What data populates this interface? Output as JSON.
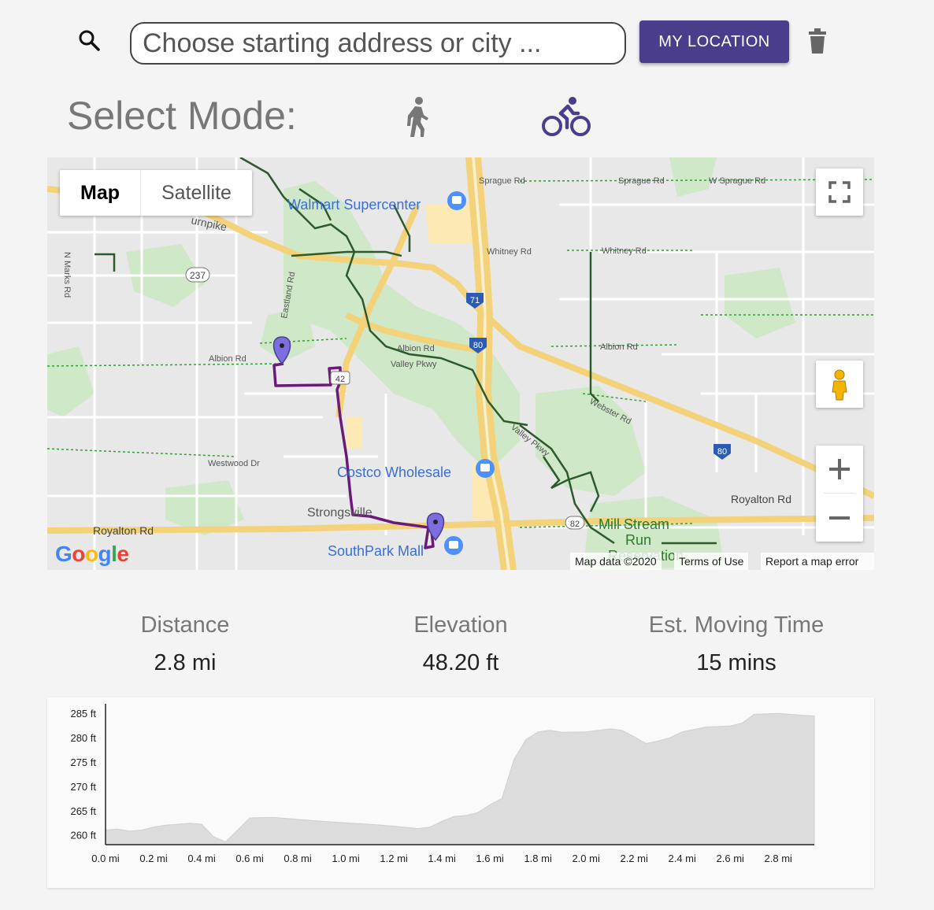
{
  "search": {
    "placeholder": "Choose starting address or city ...",
    "value": ""
  },
  "toolbar": {
    "my_location_label": "MY LOCATION"
  },
  "mode": {
    "label": "Select Mode:",
    "options": [
      "walk-icon",
      "bike-icon"
    ],
    "selected": "bike",
    "accent": "#4a3d8c"
  },
  "map": {
    "map_type_label": "Map",
    "satellite_label": "Satellite",
    "attribution": "Map data ©2020",
    "terms": "Terms of Use",
    "report": "Report a map error",
    "logo": "Google",
    "labels": {
      "walmart": "Walmart Supercenter",
      "costco": "Costco Wholesale",
      "southpark": "SouthPark Mall",
      "strongsville": "Strongsville",
      "millstream": "Mill Stream",
      "run": "Run",
      "reservation": "Reservation",
      "royalton_left": "Royalton Rd",
      "royalton_right": "Royalton Rd",
      "sprague1": "Sprague Rd",
      "sprague2": "Sprague Rd",
      "sprague3": "W Sprague Rd",
      "whitney1": "Whitney Rd",
      "whitney2": "Whitney Rd",
      "albion1": "Albion Rd",
      "albion2": "Albion Rd",
      "albion3": "Albion Rd",
      "valley1": "Valley Pkwy",
      "valley2": "Valley Pkwy",
      "westwood": "Westwood Dr",
      "webster": "Webster Rd",
      "eastland": "Eastland Rd",
      "nmarks": "N Marks Rd",
      "turnpike": "urnpike",
      "shield_237": "237",
      "shield_71": "71",
      "shield_80a": "80",
      "shield_80b": "80",
      "shield_42": "42",
      "shield_82": "82"
    }
  },
  "stats": {
    "distance_label": "Distance",
    "distance_value": "2.8 mi",
    "elevation_label": "Elevation",
    "elevation_value": "48.20 ft",
    "time_label": "Est. Moving Time",
    "time_value": "15 mins"
  },
  "chart_data": {
    "type": "area",
    "title": "",
    "xlabel": "",
    "ylabel": "",
    "xlim": [
      0,
      2.95
    ],
    "ylim": [
      258,
      286
    ],
    "x_ticks": [
      "0.0 mi",
      "0.2 mi",
      "0.4 mi",
      "0.6 mi",
      "0.8 mi",
      "1.0 mi",
      "1.2 mi",
      "1.4 mi",
      "1.6 mi",
      "1.8 mi",
      "2.0 mi",
      "2.2 mi",
      "2.4 mi",
      "2.6 mi",
      "2.8 mi"
    ],
    "y_ticks": [
      "260 ft",
      "265 ft",
      "270 ft",
      "275 ft",
      "280 ft",
      "285 ft"
    ],
    "series": [
      {
        "x": [
          0.0,
          0.05,
          0.1,
          0.15,
          0.2,
          0.25,
          0.3,
          0.35,
          0.4,
          0.45,
          0.5,
          0.55,
          0.6,
          0.7,
          0.8,
          0.9,
          1.0,
          1.1,
          1.2,
          1.3,
          1.35,
          1.4,
          1.45,
          1.5,
          1.55,
          1.6,
          1.65,
          1.7,
          1.75,
          1.8,
          1.85,
          1.9,
          2.0,
          2.1,
          2.15,
          2.2,
          2.25,
          2.3,
          2.35,
          2.4,
          2.5,
          2.6,
          2.65,
          2.7,
          2.8,
          2.9,
          2.95
        ],
        "y": [
          261,
          261.2,
          260.8,
          261,
          261.6,
          262,
          262.2,
          262.4,
          262.2,
          259.6,
          258.6,
          261,
          263.5,
          263.6,
          263.2,
          262.8,
          262.5,
          262.2,
          261.8,
          261.3,
          261.6,
          262.8,
          263.8,
          264,
          264.6,
          266.2,
          267.5,
          275.5,
          279.6,
          281.2,
          281.5,
          281.1,
          281.2,
          281.8,
          281.5,
          280.2,
          278.8,
          279.3,
          280.0,
          281.2,
          282.2,
          282.4,
          283.0,
          284.8,
          285.0,
          284.6,
          284.5
        ]
      }
    ]
  }
}
